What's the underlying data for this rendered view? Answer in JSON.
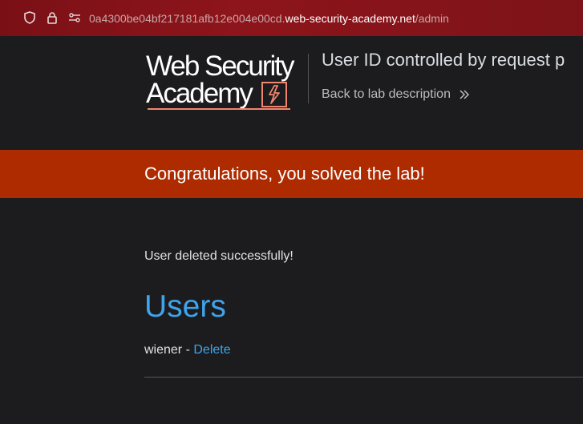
{
  "browser": {
    "url_prefix": "0a4300be04bf217181afb12e004e00cd.",
    "url_host": "web-security-academy.net",
    "url_path": "/admin"
  },
  "header": {
    "logo_line1": "Web Security",
    "logo_line2": "Academy",
    "lab_title": "User ID controlled by request p",
    "back_link": "Back to lab description"
  },
  "banner": {
    "message": "Congratulations, you solved the lab!"
  },
  "main": {
    "status_message": "User deleted successfully!",
    "heading": "Users",
    "users": [
      {
        "name": "wiener",
        "separator": " - ",
        "action": "Delete"
      }
    ]
  },
  "colors": {
    "banner": "#ae2b00",
    "link": "#3ea4ed",
    "background": "#1c1c1f",
    "urlbar": "#8d151b"
  }
}
